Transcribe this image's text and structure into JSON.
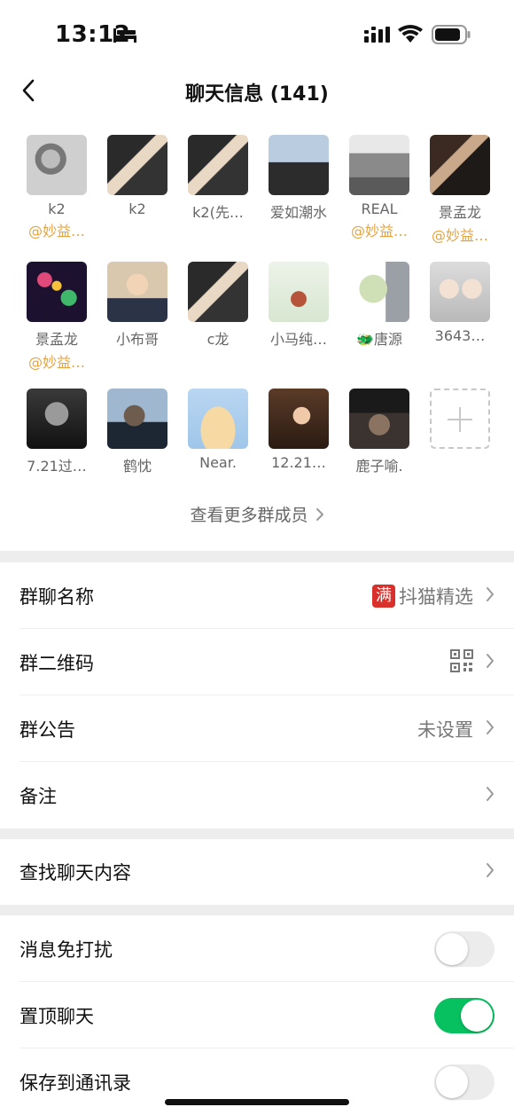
{
  "status_bar": {
    "time": "13:12"
  },
  "nav": {
    "title": "聊天信息 (141)"
  },
  "members": [
    {
      "name": "k2",
      "tag": "@妙益…"
    },
    {
      "name": "k2",
      "tag": ""
    },
    {
      "name": "k2(先…",
      "tag": ""
    },
    {
      "name": "爱如潮水",
      "tag": ""
    },
    {
      "name": "REAL",
      "tag": "@妙益…"
    },
    {
      "name": "景孟龙",
      "tag": "@妙益…"
    },
    {
      "name": "景孟龙",
      "tag": "@妙益…"
    },
    {
      "name": "小布哥",
      "tag": ""
    },
    {
      "name": "c龙",
      "tag": ""
    },
    {
      "name": "小马纯…",
      "tag": ""
    },
    {
      "name": "🐲唐源",
      "tag": ""
    },
    {
      "name": "3643…",
      "tag": ""
    },
    {
      "name": "7.21过…",
      "tag": ""
    },
    {
      "name": "鹤忱",
      "tag": ""
    },
    {
      "name": "Near.",
      "tag": ""
    },
    {
      "name": "12.21…",
      "tag": ""
    },
    {
      "name": "鹿子喻.",
      "tag": ""
    }
  ],
  "view_more": "查看更多群成员",
  "settings": {
    "group_name": {
      "label": "群聊名称",
      "badge": "满",
      "value": "抖猫精选"
    },
    "qr_code": {
      "label": "群二维码"
    },
    "announcement": {
      "label": "群公告",
      "value": "未设置"
    },
    "remark": {
      "label": "备注"
    },
    "search_chat": {
      "label": "查找聊天内容"
    },
    "mute": {
      "label": "消息免打扰",
      "on": false
    },
    "pin": {
      "label": "置顶聊天",
      "on": true
    },
    "save_contacts": {
      "label": "保存到通讯录",
      "on": false
    }
  },
  "colors": {
    "toggle_on": "#07c160",
    "tag": "#e6a340",
    "separator": "#ededed"
  }
}
